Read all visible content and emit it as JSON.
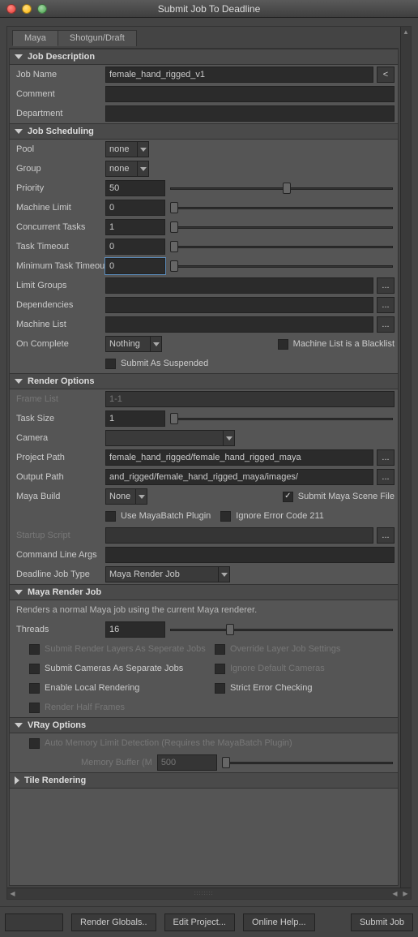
{
  "window": {
    "title": "Submit Job To Deadline"
  },
  "tabs": {
    "active": "Maya",
    "other": "Shotgun/Draft"
  },
  "job_desc": {
    "title": "Job Description",
    "name_label": "Job Name",
    "name_value": "female_hand_rigged_v1",
    "reset_btn": "<",
    "comment_label": "Comment",
    "comment_value": "",
    "dept_label": "Department",
    "dept_value": ""
  },
  "job_sched": {
    "title": "Job Scheduling",
    "pool_label": "Pool",
    "pool_value": "none",
    "group_label": "Group",
    "group_value": "none",
    "priority_label": "Priority",
    "priority_value": "50",
    "mlimit_label": "Machine Limit",
    "mlimit_value": "0",
    "ctasks_label": "Concurrent Tasks",
    "ctasks_value": "1",
    "ttimeout_label": "Task Timeout",
    "ttimeout_value": "0",
    "mintask_label": "Minimum Task Timeout",
    "mintask_value": "0",
    "limitg_label": "Limit Groups",
    "limitg_value": "",
    "deps_label": "Dependencies",
    "deps_value": "",
    "mlist_label": "Machine List",
    "mlist_value": "",
    "browse": "...",
    "oncomp_label": "On Complete",
    "oncomp_value": "Nothing",
    "blacklist_label": "Machine List is a Blacklist",
    "suspended_label": "Submit As Suspended"
  },
  "render": {
    "title": "Render Options",
    "framelist_label": "Frame List",
    "framelist_value": "1-1",
    "tasksize_label": "Task Size",
    "tasksize_value": "1",
    "camera_label": "Camera",
    "camera_value": "",
    "projpath_label": "Project Path",
    "projpath_value": "female_hand_rigged/female_hand_rigged_maya",
    "outpath_label": "Output Path",
    "outpath_value": "and_rigged/female_hand_rigged_maya/images/",
    "mayabuild_label": "Maya Build",
    "mayabuild_value": "None",
    "submitscene_label": "Submit Maya Scene File",
    "mayabatch_label": "Use MayaBatch Plugin",
    "ignore211_label": "Ignore Error Code 211",
    "startup_label": "Startup Script",
    "startup_value": "",
    "cmdline_label": "Command Line Args",
    "cmdline_value": "",
    "jobtype_label": "Deadline Job Type",
    "jobtype_value": "Maya Render Job"
  },
  "mayajob": {
    "title": "Maya Render Job",
    "desc": "Renders a normal Maya job using the current Maya renderer.",
    "threads_label": "Threads",
    "threads_value": "16",
    "layers_label": "Submit Render Layers As Seperate Jobs",
    "override_label": "Override Layer Job Settings",
    "cameras_label": "Submit Cameras As Separate Jobs",
    "ignoredef_label": "Ignore Default Cameras",
    "local_label": "Enable Local Rendering",
    "strict_label": "Strict Error Checking",
    "half_label": "Render Half Frames"
  },
  "vray": {
    "title": "VRay Options",
    "automl_label": "Auto Memory Limit Detection (Requires the MayaBatch Plugin)",
    "membuf_label": "Memory Buffer (M",
    "membuf_value": "500"
  },
  "tile": {
    "title": "Tile Rendering"
  },
  "footer": {
    "b1": "Render Globals..",
    "b2": "Edit Project...",
    "b3": "Online Help...",
    "b4": "Submit Job"
  }
}
